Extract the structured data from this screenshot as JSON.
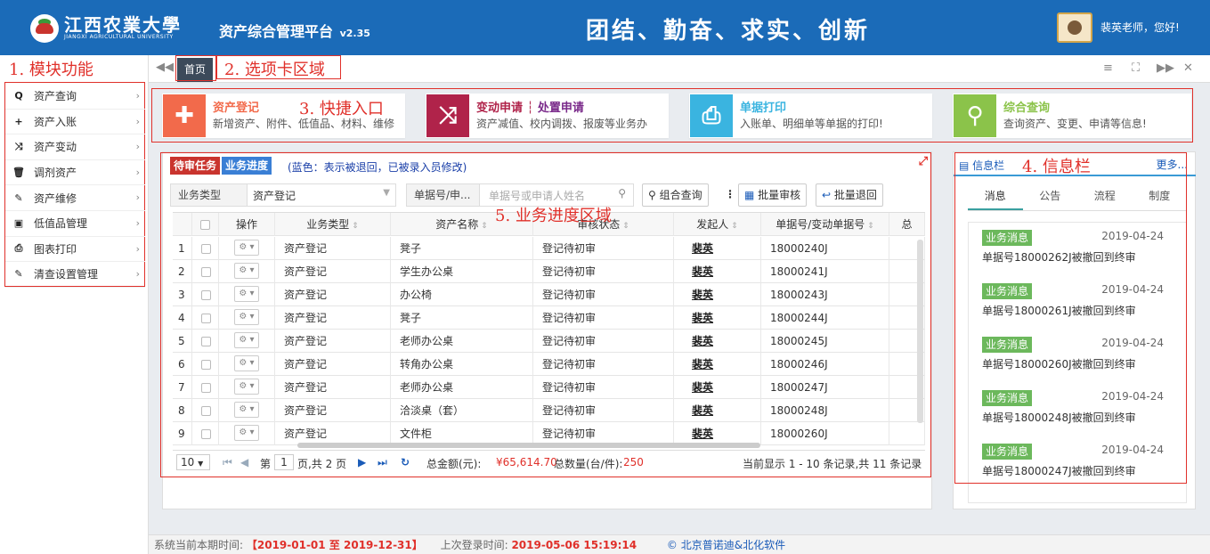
{
  "header": {
    "logo_cn": "江西农業大學",
    "logo_en": "JIANGXI AGRICULTURAL UNIVERSITY",
    "app_title": "资产综合管理平台",
    "app_version": "v2.35",
    "motto": "团结、勤奋、求实、创新",
    "greeting": "裴英老师，您好!"
  },
  "annotations": {
    "a1": "1. 模块功能",
    "a2": "2. 选项卡区域",
    "a3": "3. 快捷入口",
    "a4": "4. 信息栏",
    "a5": "5. 业务进度区域"
  },
  "sidebar": {
    "items": [
      {
        "label": "资产查询",
        "icon": "search-icon"
      },
      {
        "label": "资产入账",
        "icon": "plus-icon"
      },
      {
        "label": "资产变动",
        "icon": "shuffle-icon"
      },
      {
        "label": "调剂资产",
        "icon": "trash-icon"
      },
      {
        "label": "资产维修",
        "icon": "wrench-icon"
      },
      {
        "label": "低值品管理",
        "icon": "money-icon"
      },
      {
        "label": "图表打印",
        "icon": "print-icon"
      },
      {
        "label": "清查设置管理",
        "icon": "edit-icon"
      }
    ]
  },
  "tabs": {
    "home": "首页"
  },
  "quick": [
    {
      "title": "资产登记",
      "desc": "新增资产、附件、低值品、材料、维修",
      "color": "#f26a4b"
    },
    {
      "title": "变动申请",
      "title2": "处置申请",
      "desc": "资产减值、校内调拨、报废等业务办",
      "color": "#b0234a"
    },
    {
      "title": "单据打印",
      "desc": "入账单、明细单等单据的打印!",
      "color": "#3ab4e0"
    },
    {
      "title": "综合查询",
      "desc": "查询资产、变更、申请等信息!",
      "color": "#8bc34a"
    }
  ],
  "main": {
    "badge_pending": "待审任务",
    "badge_progress": "业务进度",
    "note": "(蓝色：表示被退回，已被录入员修改)",
    "filter1_label": "业务类型",
    "filter1_value": "资产登记",
    "filter2_label": "单据号/申...",
    "filter2_placeholder": "单据号或申请人姓名",
    "btn_combo": "组合查询",
    "btn_batch_review": "批量审核",
    "btn_batch_return": "批量退回",
    "columns": [
      "操作",
      "业务类型",
      "资产名称",
      "审核状态",
      "发起人",
      "单据号/变动单据号",
      "总"
    ],
    "rows": [
      {
        "n": "1",
        "type": "资产登记",
        "name": "凳子",
        "status": "登记待初审",
        "by": "裴英",
        "doc": "18000240J"
      },
      {
        "n": "2",
        "type": "资产登记",
        "name": "学生办公桌",
        "status": "登记待初审",
        "by": "裴英",
        "doc": "18000241J"
      },
      {
        "n": "3",
        "type": "资产登记",
        "name": "办公椅",
        "status": "登记待初审",
        "by": "裴英",
        "doc": "18000243J"
      },
      {
        "n": "4",
        "type": "资产登记",
        "name": "凳子",
        "status": "登记待初审",
        "by": "裴英",
        "doc": "18000244J"
      },
      {
        "n": "5",
        "type": "资产登记",
        "name": "老师办公桌",
        "status": "登记待初审",
        "by": "裴英",
        "doc": "18000245J"
      },
      {
        "n": "6",
        "type": "资产登记",
        "name": "转角办公桌",
        "status": "登记待初审",
        "by": "裴英",
        "doc": "18000246J"
      },
      {
        "n": "7",
        "type": "资产登记",
        "name": "老师办公桌",
        "status": "登记待初审",
        "by": "裴英",
        "doc": "18000247J"
      },
      {
        "n": "8",
        "type": "资产登记",
        "name": "洽淡桌（套）",
        "status": "登记待初审",
        "by": "裴英",
        "doc": "18000248J"
      },
      {
        "n": "9",
        "type": "资产登记",
        "name": "文件柜",
        "status": "登记待初审",
        "by": "裴英",
        "doc": "18000260J"
      }
    ],
    "pager": {
      "page_size": "10",
      "page_prefix": "第",
      "page": "1",
      "page_suffix": "页,共 2 页",
      "amount_label": "总金额(元):",
      "amount": "¥65,614.70",
      "qty_label": "总数量(台/件):",
      "qty": "250",
      "summary": "当前显示 1 - 10 条记录,共 11 条记录"
    }
  },
  "info": {
    "title": "信息栏",
    "more": "更多...",
    "tabs": [
      "消息",
      "公告",
      "流程",
      "制度"
    ],
    "messages": [
      {
        "badge": "业务消息",
        "date": "2019-04-24",
        "text": "单据号18000262J被撤回到终审"
      },
      {
        "badge": "业务消息",
        "date": "2019-04-24",
        "text": "单据号18000261J被撤回到终审"
      },
      {
        "badge": "业务消息",
        "date": "2019-04-24",
        "text": "单据号18000260J被撤回到终审"
      },
      {
        "badge": "业务消息",
        "date": "2019-04-24",
        "text": "单据号18000248J被撤回到终审"
      },
      {
        "badge": "业务消息",
        "date": "2019-04-24",
        "text": "单据号18000247J被撤回到终审"
      }
    ]
  },
  "footer": {
    "period_label": "系统当前本期时间:",
    "period": "【2019-01-01 至 2019-12-31】",
    "last_login_label": "上次登录时间:",
    "last_login": "2019-05-06 15:19:14",
    "copyright": "© 北京普诺迪&北化软件"
  }
}
